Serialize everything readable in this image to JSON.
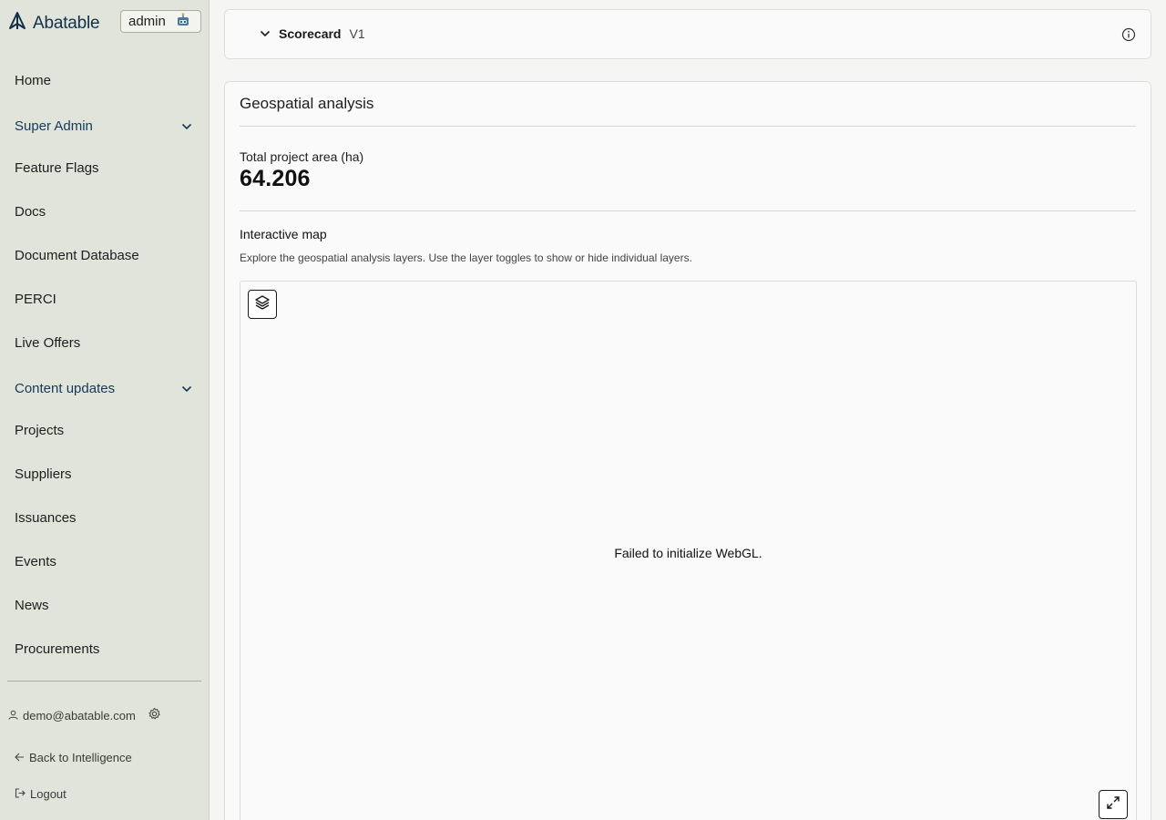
{
  "brand": {
    "name": "Abatable",
    "logo_icon": "abatable-logo-icon"
  },
  "role_switcher": {
    "label": "admin",
    "icon": "robot-icon"
  },
  "sidebar": {
    "items": [
      {
        "label": "Home"
      },
      {
        "label": "Super Admin",
        "expandable": true
      },
      {
        "label": "Feature Flags"
      },
      {
        "label": "Docs"
      },
      {
        "label": "Document Database"
      },
      {
        "label": "PERCI"
      },
      {
        "label": "Live Offers"
      },
      {
        "label": "Content updates",
        "expandable": true
      },
      {
        "label": "Projects"
      },
      {
        "label": "Suppliers"
      },
      {
        "label": "Issuances"
      },
      {
        "label": "Events"
      },
      {
        "label": "News"
      },
      {
        "label": "Procurements"
      }
    ],
    "footer": {
      "user_email": "demo@abatable.com",
      "back_label": "Back to Intelligence",
      "logout_label": "Logout"
    }
  },
  "scorecard": {
    "title": "Scorecard",
    "version": "V1"
  },
  "geospatial": {
    "title": "Geospatial analysis",
    "metric_label": "Total project area (ha)",
    "metric_value": "64.206",
    "map_title": "Interactive map",
    "map_description": "Explore the geospatial analysis layers. Use the layer toggles to show or hide individual layers.",
    "map_error": "Failed to initialize WebGL."
  },
  "colors": {
    "sidebar_bg": "#e1e4da",
    "brand": "#13304a",
    "group_label": "#14395a",
    "page_bg": "#f5f5f3"
  }
}
